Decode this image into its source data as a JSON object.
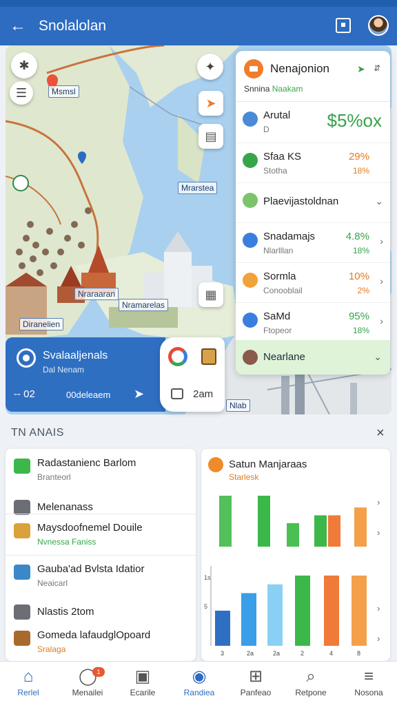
{
  "app_bar": {
    "title": "Snolalolan",
    "back_icon": "arrow-left-icon",
    "clipboard_icon": "clipboard-icon",
    "avatar_icon": "avatar-icon"
  },
  "map": {
    "tags": [
      "Msmsl",
      "Mrarstea",
      "Nraraaran",
      "Nramarelas",
      "Diranelien",
      "Nlab"
    ],
    "controls": [
      "compass-icon",
      "layers-icon",
      "direction-icon",
      "list-icon",
      "map-frame-icon"
    ]
  },
  "panel": {
    "title": "Nenajonion",
    "subtitle_a": "Snnina",
    "subtitle_b": "Naakam",
    "header_icon": "navigation-icon",
    "rows": [
      {
        "name": "Arutal",
        "sub": "D",
        "value": "$5%ox",
        "value2": "",
        "icon_color": "#4a8ad6",
        "value_color": "#36a24a"
      },
      {
        "name": "Sfaa KS",
        "sub": "Stotha",
        "value": "29%",
        "value2": "18%",
        "icon_color": "#37a64a",
        "value_color": "#e07b22"
      },
      {
        "name": "Plaevijastoldnan",
        "sub": "",
        "value": "",
        "value2": "",
        "icon_color": "#7bc46a",
        "value_color": "#222",
        "chevron": "down"
      },
      {
        "name": "Snadamajs",
        "sub": "Nlarlllan",
        "value": "4.8%",
        "value2": "18%",
        "icon_color": "#3a7fe0",
        "value_color": "#36a24a",
        "chevron": "right"
      },
      {
        "name": "Sormla",
        "sub": "Conooblail",
        "value": "10%",
        "value2": "2%",
        "icon_color": "#f2a23a",
        "value_color": "#e07b22",
        "chevron": "right"
      },
      {
        "name": "SaMd",
        "sub": "Ftopeor",
        "value": "95%",
        "value2": "18%",
        "icon_color": "#3a7fe0",
        "value_color": "#36a24a",
        "chevron": "right"
      }
    ],
    "footer": "Nearlane"
  },
  "location": {
    "title": "Svalaaljenals",
    "sub": "Dal Nenam",
    "dist": "-- 02",
    "label": "00deleaem",
    "time": "2am"
  },
  "section": {
    "title": "TN ANAIS",
    "close_icon": "close-icon"
  },
  "list": [
    {
      "name": "Radastanienc Barlom",
      "sub": "Branteorl",
      "icon": "green",
      "sub_color": "#777"
    },
    {
      "name": "Melenanass",
      "sub": "",
      "icon": "gray",
      "sub_color": "#777"
    },
    {
      "name": "Maysdoofnemel Douile",
      "sub": "Nvnessa Faniss",
      "icon": "yellow",
      "sub_color": "#37a64a"
    },
    {
      "name": "Gauba'ad Bvlsta Idatior",
      "sub": "Neaicarl",
      "icon": "blue",
      "sub_color": "#777"
    },
    {
      "name": "Nlastis 2tom",
      "sub": "",
      "icon": "gray",
      "sub_color": "#777"
    },
    {
      "name": "Gomeda lafaudglOpoard",
      "sub": "Sralaga",
      "icon": "brown",
      "sub_color": "#e07b22"
    }
  ],
  "chart_card": {
    "title": "Satun Manjaraas",
    "subtitle": "Starlesk"
  },
  "chart_data": [
    {
      "type": "bar",
      "title": "Satun Manjaraas",
      "categories": [
        "",
        "",
        "",
        "",
        "",
        ""
      ],
      "series": [
        {
          "values": [
            13,
            13,
            6,
            8,
            8,
            10
          ],
          "colors": [
            "#54c05a",
            "#3cb84a",
            "#4bbf52",
            "#3cb84a",
            "#f07a3a",
            "#f4a04a"
          ]
        }
      ]
    },
    {
      "type": "bar",
      "y_ticks": [
        "5",
        "1s"
      ],
      "categories": [
        "3",
        "2a",
        "2a",
        "2",
        "4",
        "8"
      ],
      "series": [
        {
          "values": [
            6,
            9,
            10.5,
            12,
            12,
            12
          ],
          "colors": [
            "#2f6fc2",
            "#3a9ee8",
            "#8ad0f4",
            "#3cb84a",
            "#f07a3a",
            "#f4a04a"
          ]
        }
      ]
    }
  ],
  "bottom_nav": [
    {
      "label": "Rerlel",
      "icon": "home-icon",
      "active": true
    },
    {
      "label": "Menailei",
      "icon": "chat-icon",
      "badge": "1"
    },
    {
      "label": "Ecarile",
      "icon": "bookmark-icon"
    },
    {
      "label": "Randiea",
      "icon": "location-icon",
      "active": true
    },
    {
      "label": "Panfeao",
      "icon": "grid-icon"
    },
    {
      "label": "Retpone",
      "icon": "search-icon"
    },
    {
      "label": "Nosona",
      "icon": "menu-icon"
    }
  ]
}
